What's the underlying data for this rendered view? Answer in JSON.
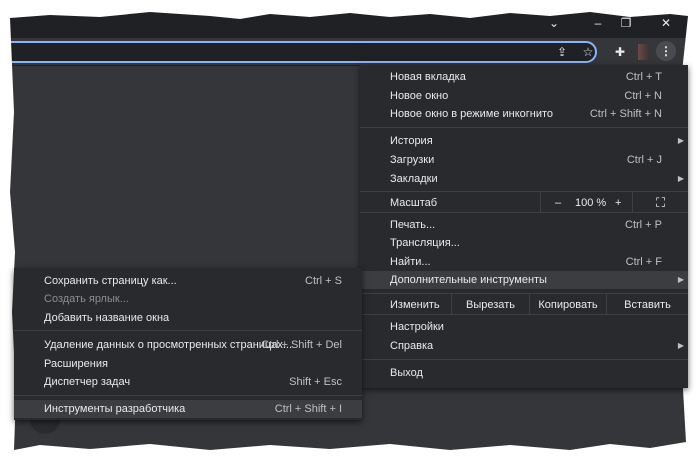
{
  "window": {
    "dropdown": "⌄",
    "minimize": "–",
    "restore": "❐",
    "close": "✕"
  },
  "toolbar": {
    "share": "⇪",
    "star": "☆",
    "extensions": "✚",
    "menu": "⋮"
  },
  "main_menu": {
    "items": [
      {
        "label": "Новая вкладка",
        "shortcut": "Ctrl + T"
      },
      {
        "label": "Новое окно",
        "shortcut": "Ctrl + N"
      },
      {
        "label": "Новое окно в режиме инкогнито",
        "shortcut": "Ctrl + Shift + N"
      },
      {
        "label": "История",
        "shortcut": ""
      },
      {
        "label": "Загрузки",
        "shortcut": "Ctrl + J"
      },
      {
        "label": "Закладки",
        "shortcut": ""
      },
      {
        "label": "Печать...",
        "shortcut": "Ctrl + P"
      },
      {
        "label": "Трансляция...",
        "shortcut": ""
      },
      {
        "label": "Найти...",
        "shortcut": "Ctrl + F"
      },
      {
        "label": "Дополнительные инструменты",
        "shortcut": ""
      },
      {
        "label": "Настройки",
        "shortcut": ""
      },
      {
        "label": "Справка",
        "shortcut": ""
      },
      {
        "label": "Выход",
        "shortcut": ""
      }
    ],
    "zoom": {
      "label": "Масштаб",
      "minus": "–",
      "value": "100 %",
      "plus": "+",
      "fullscreen": "⛶"
    },
    "edit": {
      "label": "Изменить",
      "cut": "Вырезать",
      "copy": "Копировать",
      "paste": "Вставить"
    },
    "arrow": "▶"
  },
  "submenu": {
    "items": [
      {
        "label": "Сохранить страницу как...",
        "shortcut": "Ctrl + S"
      },
      {
        "label": "Создать ярлык...",
        "shortcut": ""
      },
      {
        "label": "Добавить название окна",
        "shortcut": ""
      },
      {
        "label": "Удаление данных о просмотренных страницах...",
        "shortcut": "Ctrl + Shift + Del"
      },
      {
        "label": "Расширения",
        "shortcut": ""
      },
      {
        "label": "Диспетчер задач",
        "shortcut": "Shift + Esc"
      },
      {
        "label": "Инструменты разработчика",
        "shortcut": "Ctrl + Shift + I"
      }
    ]
  }
}
